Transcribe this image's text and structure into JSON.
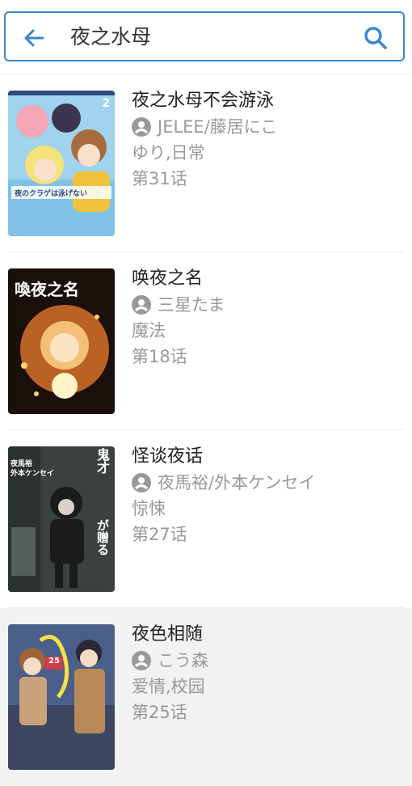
{
  "search": {
    "query": "夜之水母",
    "back_icon": "arrow-left-icon",
    "search_icon": "search-icon",
    "accent": "#3a86cf"
  },
  "results": [
    {
      "title": "夜之水母不会游泳",
      "author": "JELEE/藤居にこ",
      "tags": "ゆり,日常",
      "chapter": "第31话",
      "cover_number": "2",
      "cover_caption": "夜のクラゲは泳げない"
    },
    {
      "title": "唤夜之名",
      "author": "三星たま",
      "tags": "魔法",
      "chapter": "第18话",
      "cover_title": "喚夜之名"
    },
    {
      "title": "怪谈夜话",
      "author": "夜馬裕/外本ケンセイ",
      "tags": "惊悚",
      "chapter": "第27话",
      "cover_side_a": "鬼才",
      "cover_side_b": "が贈る",
      "cover_name_a": "夜馬裕",
      "cover_name_b": "外本ケンセイ"
    },
    {
      "title": "夜色相随",
      "author": "こう森",
      "tags": "爱情,校园",
      "chapter": "第25话",
      "cover_badge": "25"
    }
  ],
  "colors": {
    "meta_text": "#999999",
    "highlight_row": "#f2f2f2"
  }
}
